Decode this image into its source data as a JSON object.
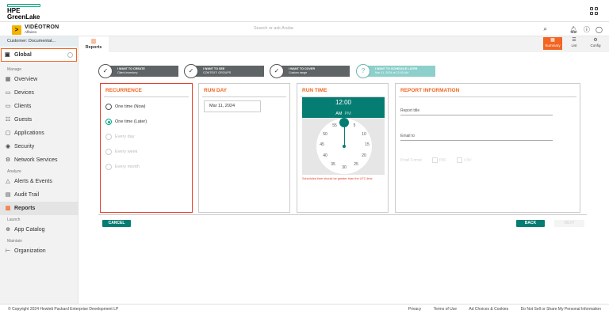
{
  "header": {
    "logo_line1": "HPE",
    "logo_line2": "GreenLake",
    "apps_icon": "grid-icon"
  },
  "subheader": {
    "brand_badge": ">",
    "brand_name": "VIDÉOTRON",
    "brand_sub": "Affaires",
    "search_placeholder": "Search or ask Aruba",
    "icons": [
      "search-icon",
      "bell-icon",
      "help-icon",
      "user-icon"
    ]
  },
  "sidebar": {
    "customer": "Customer: Documentat...",
    "global": "Global",
    "groups": {
      "manage": "Manage",
      "analyze": "Analyze",
      "launch": "Launch",
      "maintain": "Maintain"
    },
    "items": [
      {
        "label": "Overview",
        "icon": "▦"
      },
      {
        "label": "Devices",
        "icon": "▭"
      },
      {
        "label": "Clients",
        "icon": "▭"
      },
      {
        "label": "Guests",
        "icon": "☷"
      },
      {
        "label": "Applications",
        "icon": "▢"
      },
      {
        "label": "Security",
        "icon": "◉"
      },
      {
        "label": "Network Services",
        "icon": "⚙"
      },
      {
        "label": "Alerts & Events",
        "icon": "△"
      },
      {
        "label": "Audit Trail",
        "icon": "▤"
      },
      {
        "label": "Reports",
        "icon": "▥"
      },
      {
        "label": "App Catalog",
        "icon": "⊕"
      },
      {
        "label": "Organization",
        "icon": "⊢"
      }
    ]
  },
  "tabs": {
    "reports": "Reports",
    "summary": "Summary",
    "list": "List",
    "config": "Config"
  },
  "steps": [
    {
      "title": "I WANT TO CREATE",
      "sub": "Client inventory"
    },
    {
      "title": "I WANT TO SEE",
      "sub": "CONTEXT: GROUPS"
    },
    {
      "title": "I WANT TO COVER",
      "sub": "Custom range"
    },
    {
      "title": "I WANT TO SCHEDULE LATER",
      "sub": "Mar 11, 2024 at 12:00 AM"
    }
  ],
  "recurrence": {
    "title": "RECURRENCE",
    "options": [
      "One time (Now)",
      "One time (Later)",
      "Every day",
      "Every week",
      "Every month"
    ],
    "selected": "One time (Later)"
  },
  "run_day": {
    "title": "RUN DAY",
    "value": "Mar 11, 2024"
  },
  "run_time": {
    "title": "RUN TIME",
    "hour": "12",
    "colon": ":",
    "minute": "00",
    "am": "AM",
    "pm": "PM",
    "clock_numbers": [
      "55",
      "5",
      "50",
      "10",
      "45",
      "15",
      "40",
      "20",
      "35",
      "25",
      "30"
    ],
    "error": "Scheduled time should be greater than the UTC time"
  },
  "report_info": {
    "title": "REPORT INFORMATION",
    "report_title_label": "Report title",
    "email_label": "Email to",
    "format_label": "Email Format",
    "pdf": "PDF",
    "csv": "CSV"
  },
  "buttons": {
    "cancel": "CANCEL",
    "back": "BACK",
    "next": "NEXT"
  },
  "footer": {
    "copyright": "© Copyright 2024 Hewlett Packard Enterprise Development LP",
    "links": [
      "Privacy",
      "Terms of Use",
      "Ad Choices & Cookies",
      "Do Not Sell or Share My Personal Information"
    ]
  }
}
